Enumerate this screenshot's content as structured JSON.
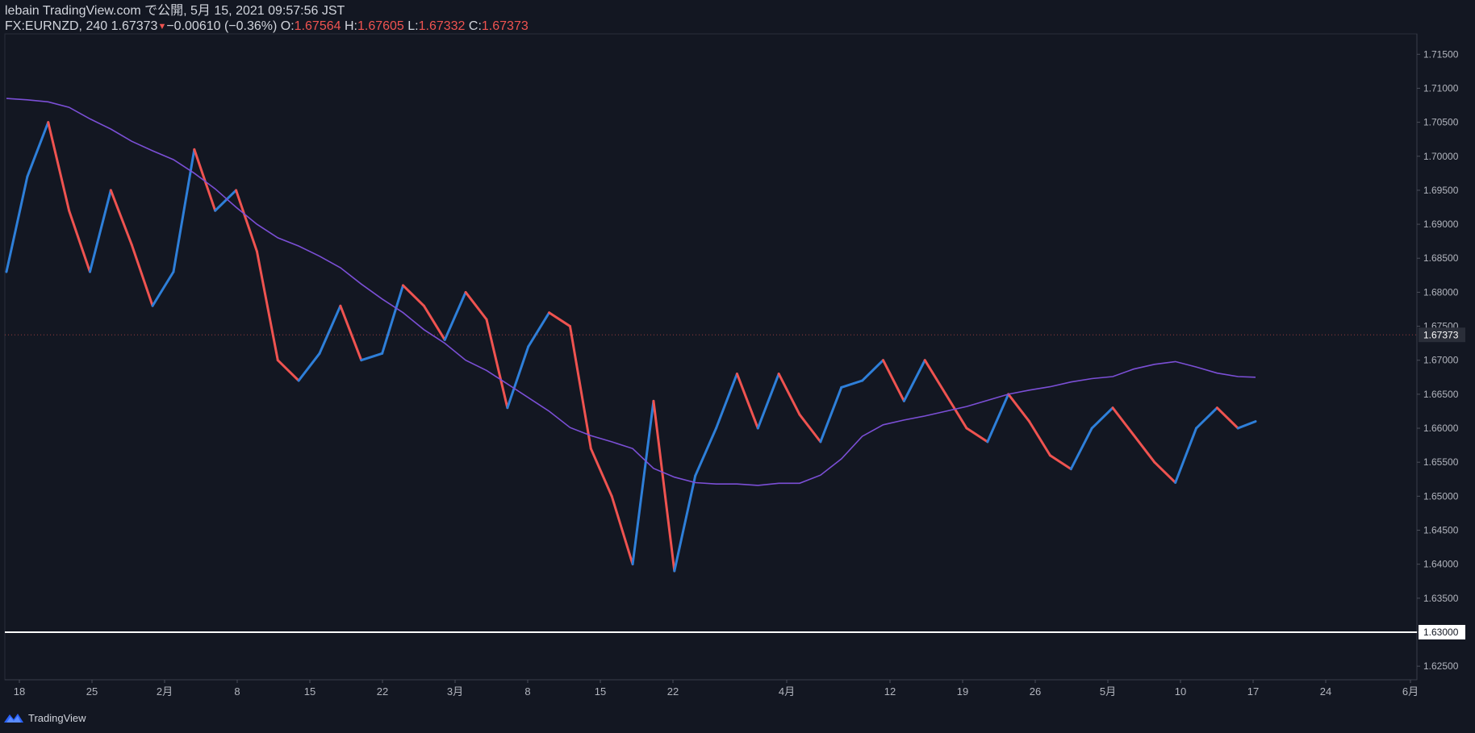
{
  "header": {
    "line1": "lebain TradingView.com で公開, 5月 15, 2021 09:57:56 JST",
    "symbol": "FX:EURNZD, 240",
    "last": "1.67373",
    "change": "−0.00610 (−0.36%)",
    "o_label": "O:",
    "o_value": "1.67564",
    "h_label": "H:",
    "h_value": "1.67605",
    "l_label": "L:",
    "l_value": "1.67332",
    "c_label": "C:",
    "c_value": "1.67373"
  },
  "footer": {
    "brand": "TradingView",
    "logo_icon": "tradingview-logo-icon"
  },
  "chart_data": {
    "type": "line",
    "ylim": [
      1.623,
      1.718
    ],
    "y_ticks": [
      "1.71500",
      "1.71000",
      "1.70500",
      "1.70000",
      "1.69500",
      "1.69000",
      "1.68500",
      "1.68000",
      "1.67500",
      "1.67000",
      "1.66500",
      "1.66000",
      "1.65500",
      "1.65000",
      "1.64500",
      "1.64000",
      "1.63500",
      "1.63000",
      "1.62500"
    ],
    "x_ticks": [
      "18",
      "25",
      "2月",
      "8",
      "15",
      "22",
      "3月",
      "8",
      "15",
      "22",
      "4月",
      "12",
      "19",
      "26",
      "5月",
      "10",
      "17",
      "24",
      "6月"
    ],
    "current_price": {
      "label": "1.67373",
      "value": 1.67373
    },
    "horizontal_line": {
      "label": "1.63000",
      "value": 1.63
    },
    "colors": {
      "up": "#2e7fd9",
      "down": "#ef5350",
      "ma": "#7b4fd6",
      "background": "#131722"
    },
    "series": [
      {
        "type": "line",
        "role": "moving-average",
        "x": [
          0,
          25,
          50,
          75,
          100,
          125,
          150,
          175,
          200,
          225,
          250,
          275,
          300,
          325,
          350,
          375,
          400,
          425,
          450,
          475,
          500,
          525,
          550,
          575,
          600,
          625,
          650,
          675,
          700,
          725,
          750,
          775,
          800,
          825,
          850,
          875,
          900,
          925,
          950,
          975,
          1000,
          1025,
          1050,
          1075,
          1100,
          1125,
          1150,
          1175,
          1200,
          1225,
          1250,
          1275,
          1300,
          1325,
          1350,
          1375,
          1400,
          1425,
          1450,
          1475,
          1496
        ],
        "y": [
          1.7085,
          1.7083,
          1.708,
          1.7072,
          1.7055,
          1.704,
          1.7022,
          1.7008,
          1.6995,
          1.6975,
          1.6952,
          1.6925,
          1.69,
          1.688,
          1.6868,
          1.6853,
          1.6836,
          1.6812,
          1.679,
          1.677,
          1.6745,
          1.6725,
          1.67,
          1.6685,
          1.6665,
          1.6645,
          1.6625,
          1.6601,
          1.6589,
          1.658,
          1.657,
          1.6541,
          1.6528,
          1.652,
          1.6518,
          1.6518,
          1.6516,
          1.6519,
          1.6519,
          1.6531,
          1.6555,
          1.6588,
          1.6605,
          1.6612,
          1.6618,
          1.6625,
          1.6632,
          1.6641,
          1.665,
          1.6656,
          1.6661,
          1.6668,
          1.6673,
          1.6676,
          1.6687,
          1.6694,
          1.6698,
          1.669,
          1.6681,
          1.6676,
          1.6675
        ]
      },
      {
        "type": "line",
        "role": "price-path",
        "x": [
          0,
          25,
          50,
          75,
          100,
          125,
          150,
          175,
          200,
          225,
          250,
          275,
          300,
          325,
          350,
          375,
          400,
          425,
          450,
          475,
          500,
          525,
          550,
          575,
          600,
          625,
          650,
          675,
          700,
          725,
          750,
          775,
          800,
          825,
          850,
          875,
          900,
          925,
          950,
          975,
          1000,
          1025,
          1050,
          1075,
          1100,
          1125,
          1150,
          1175,
          1200,
          1225,
          1250,
          1275,
          1300,
          1325,
          1350,
          1375,
          1400,
          1425,
          1450,
          1475,
          1496
        ],
        "y": [
          1.683,
          1.697,
          1.705,
          1.692,
          1.683,
          1.695,
          1.687,
          1.678,
          1.683,
          1.701,
          1.692,
          1.695,
          1.686,
          1.67,
          1.667,
          1.671,
          1.678,
          1.67,
          1.671,
          1.681,
          1.678,
          1.673,
          1.68,
          1.676,
          1.663,
          1.672,
          1.677,
          1.675,
          1.657,
          1.65,
          1.64,
          1.664,
          1.639,
          1.653,
          1.66,
          1.668,
          1.66,
          1.668,
          1.662,
          1.658,
          1.666,
          1.667,
          1.67,
          1.664,
          1.67,
          1.665,
          1.66,
          1.658,
          1.665,
          1.661,
          1.656,
          1.654,
          1.66,
          1.663,
          1.659,
          1.655,
          1.652,
          1.66,
          1.663,
          1.66,
          1.661
        ]
      }
    ]
  }
}
